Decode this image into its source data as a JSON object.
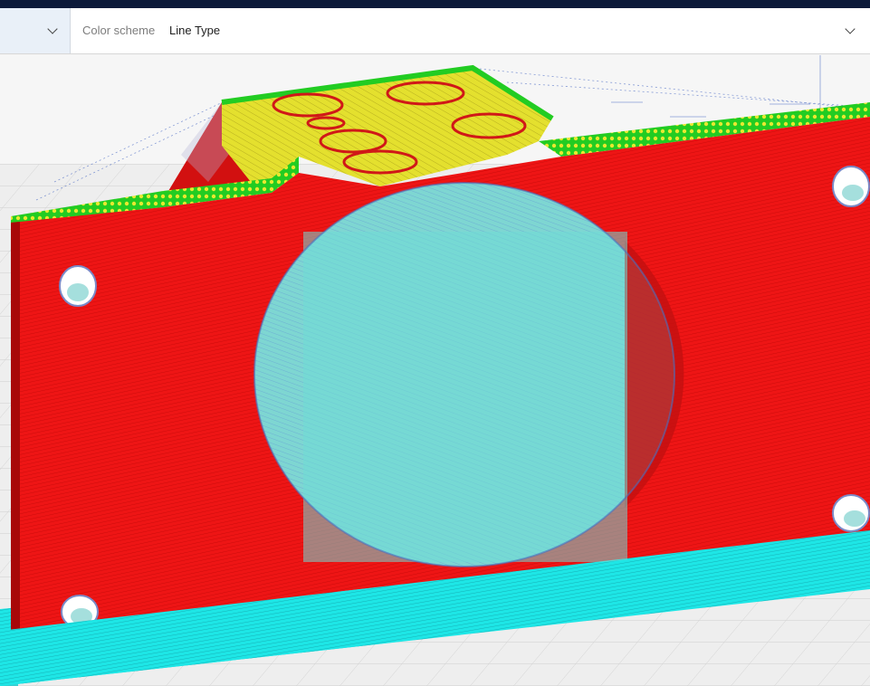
{
  "toolbar": {
    "color_scheme_label": "Color scheme",
    "color_scheme_value": "Line Type"
  },
  "viewport": {
    "legend_colors": {
      "outer_wall": "#ee1111",
      "inner_wall": "#22cc22",
      "top_bottom": "#e8e830",
      "support": "#22e6e6",
      "travel": "#3c5fc0"
    }
  }
}
